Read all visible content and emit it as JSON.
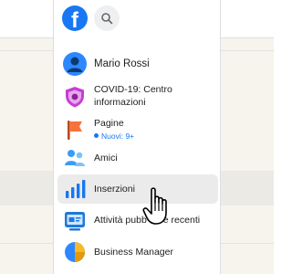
{
  "sidebar": {
    "logo_icon": "facebook-logo-icon",
    "search_icon": "search-icon",
    "profile": {
      "name": "Mario Rossi",
      "icon": "avatar-icon"
    },
    "items": [
      {
        "label": "COVID-19: Centro",
        "label2": "informazioni",
        "icon": "covid-shield-icon"
      },
      {
        "label": "Pagine",
        "sub": "Nuovi: 9+",
        "icon": "flag-icon"
      },
      {
        "label": "Amici",
        "icon": "friends-icon"
      },
      {
        "label": "Inserzioni",
        "icon": "bar-chart-icon",
        "highlighted": true
      },
      {
        "label": "Attività pubb",
        "label_tail": "e recenti",
        "icon": "ads-activity-icon"
      },
      {
        "label": "Business Manager",
        "icon": "business-manager-icon"
      }
    ]
  },
  "colors": {
    "brand": "#1877f2",
    "covid": "#c53fd1",
    "flag": "#f5733d",
    "highlight": "#ebebeb"
  },
  "cursor": {
    "icon": "hand-pointer-icon"
  }
}
